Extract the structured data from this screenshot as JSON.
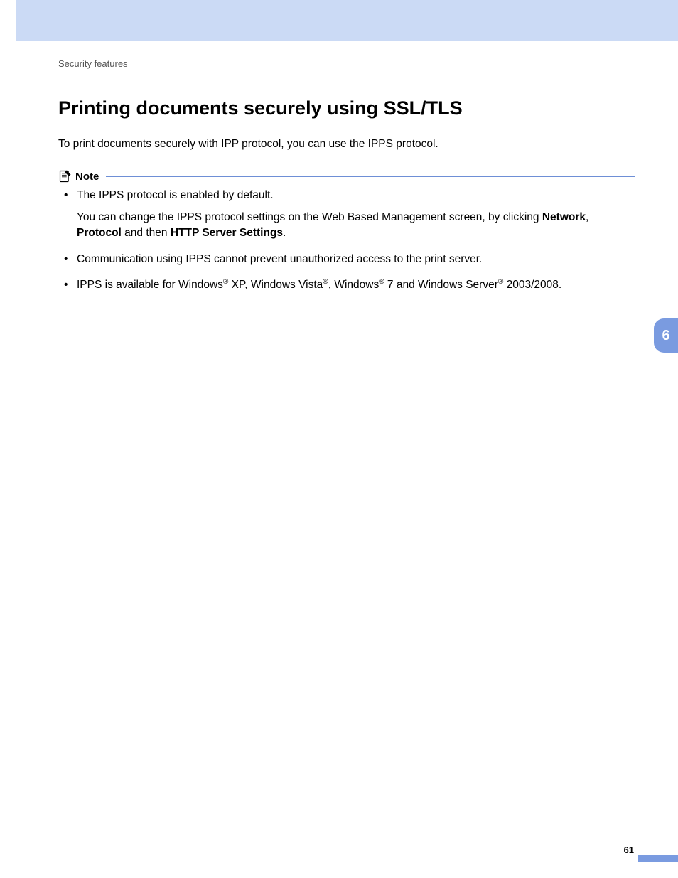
{
  "breadcrumb": "Security features",
  "title": "Printing documents securely using SSL/TLS",
  "intro": "To print documents securely with IPP protocol, you can use the IPPS protocol.",
  "note": {
    "label": "Note",
    "items": {
      "b1_line1": "The IPPS protocol is enabled by default.",
      "b1_line2_pre": "You can change the IPPS protocol settings on the Web Based Management screen, by clicking ",
      "b1_net": "Network",
      "b1_comma": ", ",
      "b1_proto": "Protocol",
      "b1_and": " and then ",
      "b1_http": "HTTP Server Settings",
      "b1_period": ".",
      "b2": "Communication using IPPS cannot prevent unauthorized access to the print server.",
      "b3_pre": "IPPS is available for Windows",
      "b3_xp": " XP, Windows Vista",
      "b3_win7_pre": ", Windows",
      "b3_win7": " 7 and Windows Server",
      "b3_tail": " 2003/2008.",
      "reg": "®"
    }
  },
  "chapter_tab": "6",
  "page_number": "61"
}
